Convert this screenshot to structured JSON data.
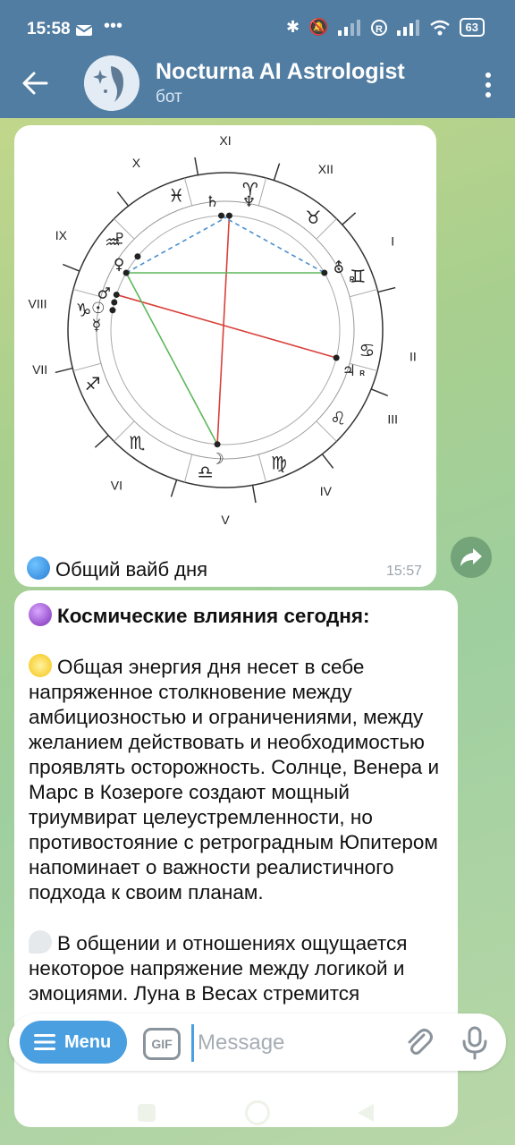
{
  "status": {
    "time": "15:58",
    "battery": "63"
  },
  "header": {
    "title": "Nocturna AI Astrologist",
    "subtitle": "бот"
  },
  "chart": {
    "houses": [
      "I",
      "II",
      "III",
      "IV",
      "V",
      "VI",
      "VII",
      "VIII",
      "IX",
      "X",
      "XI",
      "XII"
    ],
    "signs": [
      "♓",
      "♈",
      "♉",
      "♊",
      "♋",
      "♌",
      "♍",
      "♎",
      "♏",
      "♐",
      "♑",
      "♒"
    ],
    "planets": [
      "♄",
      "♆",
      "⛢",
      "♃",
      "☽",
      "♀",
      "♂",
      "☉",
      "☿",
      "♇"
    ],
    "retro": "R"
  },
  "message1": {
    "caption": "Общий вайб дня",
    "time": "15:57"
  },
  "message2": {
    "heading": "Космические влияния сегодня:",
    "para1": "Общая энергия дня несет в себе напряженное столкновение между амбициозностью и ограничениями, между желанием действовать и необходимостью проявлять осторожность. Солнце, Венера и Марс в Козероге создают мощный триумвират целеустремленности, но противостояние с ретроградным Юпитером напоминает о важности реалистичного подхода к своим планам.",
    "para2": "В общении и отношениях ощущается некоторое напряжение между логикой и эмоциями. Луна в Весах стремится"
  },
  "input": {
    "menu_label": "Menu",
    "gif_label": "GIF",
    "placeholder": "Message"
  },
  "colors": {
    "header": "#517da2",
    "accent": "#4a9fe0",
    "trine": "#5cb85c",
    "square": "#d9403a",
    "sextile": "#4a8fd0"
  }
}
